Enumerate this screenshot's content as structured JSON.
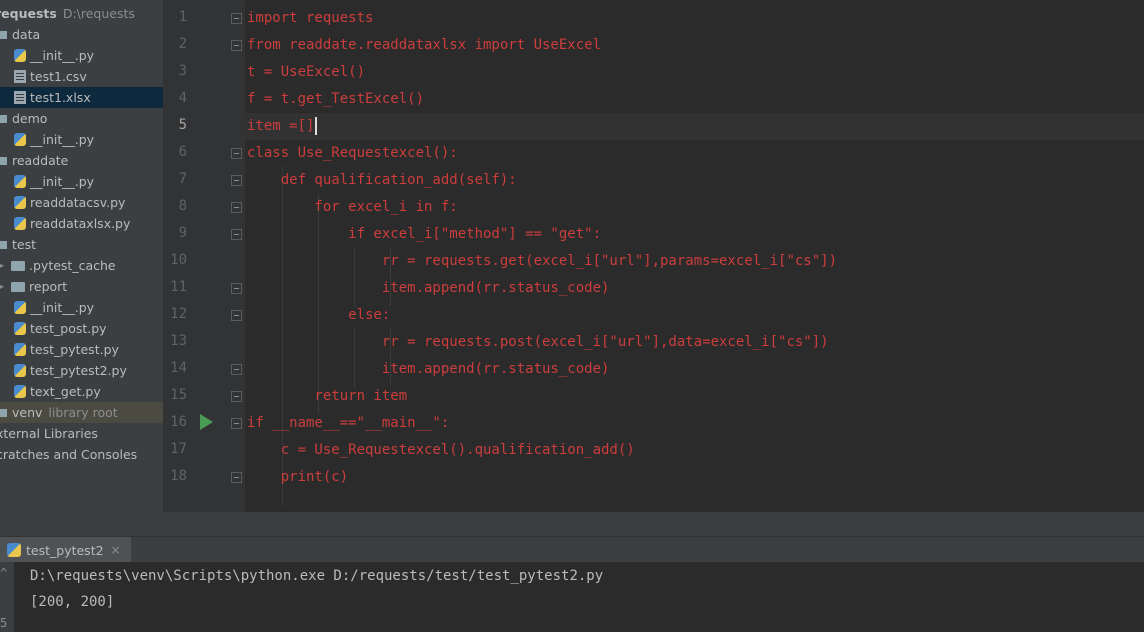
{
  "project": {
    "root_name": "requests",
    "root_path": "D:\\requests",
    "items": [
      {
        "label": "data",
        "kind": "folder",
        "depth": 0
      },
      {
        "label": "__init__.py",
        "kind": "py",
        "depth": 1
      },
      {
        "label": "test1.csv",
        "kind": "csv",
        "depth": 1
      },
      {
        "label": "test1.xlsx",
        "kind": "xlsx",
        "depth": 1,
        "selected": true
      },
      {
        "label": "demo",
        "kind": "folder",
        "depth": 0
      },
      {
        "label": "__init__.py",
        "kind": "py",
        "depth": 1
      },
      {
        "label": "readdate",
        "kind": "folder",
        "depth": 0
      },
      {
        "label": "__init__.py",
        "kind": "py",
        "depth": 1
      },
      {
        "label": "readdatacsv.py",
        "kind": "py",
        "depth": 1
      },
      {
        "label": "readdataxlsx.py",
        "kind": "py",
        "depth": 1
      },
      {
        "label": "test",
        "kind": "folder",
        "depth": 0
      },
      {
        "label": ".pytest_cache",
        "kind": "subfolder",
        "depth": 1
      },
      {
        "label": "report",
        "kind": "subfolder",
        "depth": 1
      },
      {
        "label": "__init__.py",
        "kind": "py",
        "depth": 1
      },
      {
        "label": "test_post.py",
        "kind": "py",
        "depth": 1
      },
      {
        "label": "test_pytest.py",
        "kind": "py",
        "depth": 1
      },
      {
        "label": "test_pytest2.py",
        "kind": "py",
        "depth": 1
      },
      {
        "label": "text_get.py",
        "kind": "py",
        "depth": 1
      },
      {
        "label": "venv",
        "kind": "venv",
        "depth": 0,
        "extra": "library root"
      },
      {
        "label": "xternal Libraries",
        "kind": "plain",
        "depth": 0
      },
      {
        "label": "cratches and Consoles",
        "kind": "plain",
        "depth": 0
      }
    ]
  },
  "editor": {
    "line_numbers": [
      "1",
      "2",
      "3",
      "4",
      "5",
      "6",
      "7",
      "8",
      "9",
      "10",
      "11",
      "12",
      "13",
      "14",
      "15",
      "16",
      "17",
      "18"
    ],
    "current_line": "5",
    "lines": [
      "import requests",
      "from readdate.readdataxlsx import UseExcel",
      "t = UseExcel()",
      "f = t.get_TestExcel()",
      "item =[]",
      "class Use_Requestexcel():",
      "    def qualification_add(self):",
      "        for excel_i in f:",
      "            if excel_i[\"method\"] == \"get\":",
      "                rr = requests.get(excel_i[\"url\"],params=excel_i[\"cs\"])",
      "                item.append(rr.status_code)",
      "            else:",
      "                rr = requests.post(excel_i[\"url\"],data=excel_i[\"cs\"])",
      "                item.append(rr.status_code)",
      "        return item",
      "if __name__==\"__main__\":",
      "    c = Use_Requestexcel().qualification_add()",
      "    print(c)"
    ]
  },
  "run": {
    "tab_label": "test_pytest2",
    "close_symbol": "×",
    "output": [
      "D:\\requests\\venv\\Scripts\\python.exe D:/requests/test/test_pytest2.py",
      "[200, 200]"
    ],
    "side_marks": [
      "^",
      "5"
    ]
  },
  "colors": {
    "code_text": "#cc3d3d",
    "run_arrow": "#499c54",
    "selection": "#0d293e"
  }
}
